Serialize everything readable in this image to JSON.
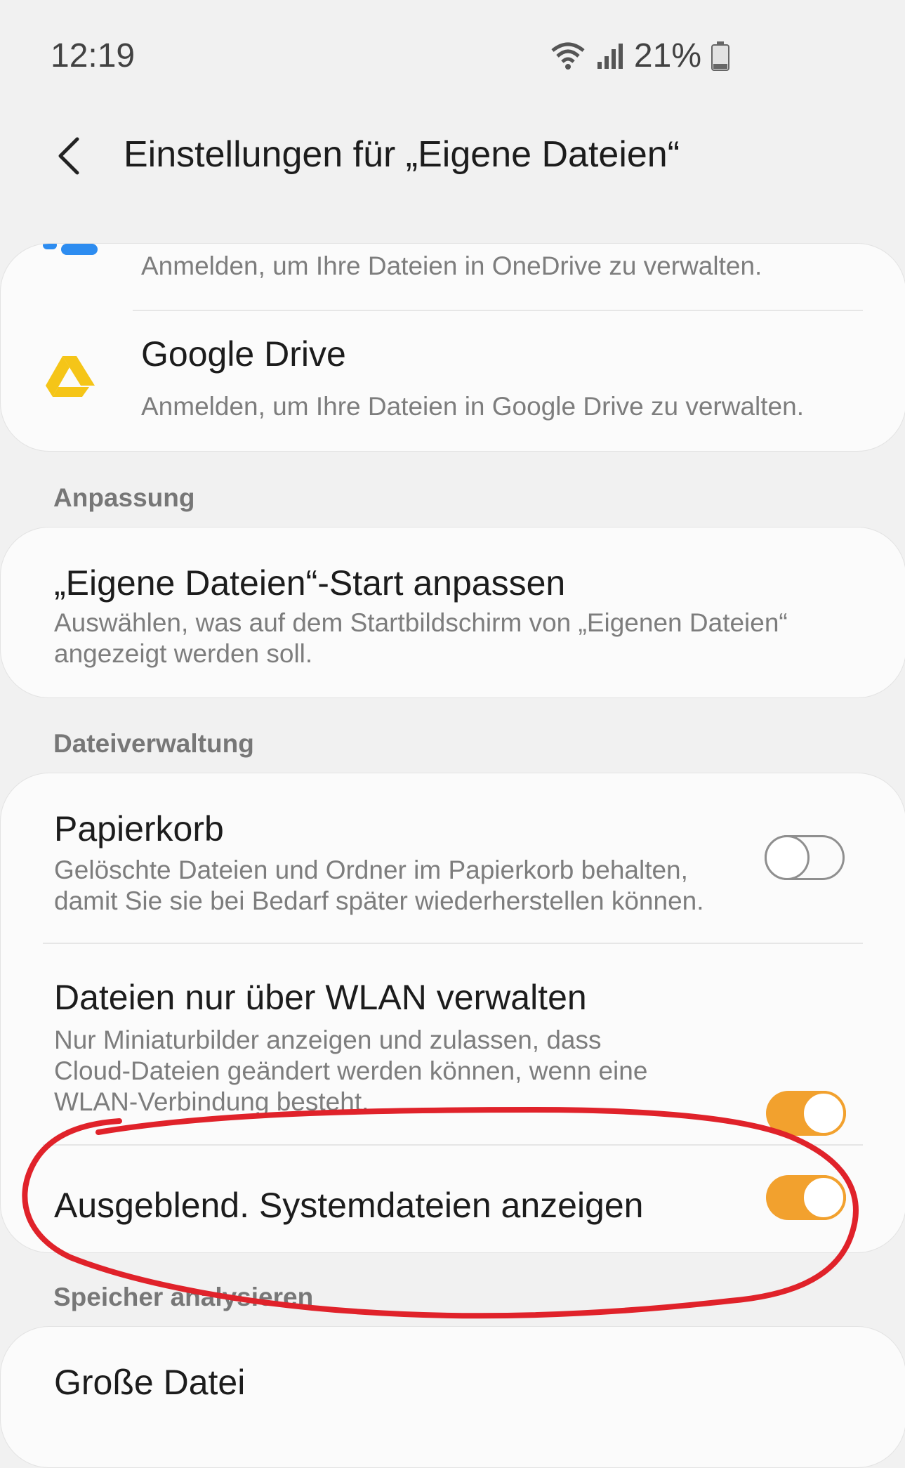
{
  "status_bar": {
    "time": "12:19",
    "battery_percent": "21%",
    "icons": [
      "wifi-icon",
      "signal-icon",
      "battery-icon"
    ]
  },
  "header": {
    "back_icon": "arrow-back-icon",
    "title": "Einstellungen für „Eigene Dateien“"
  },
  "cloud": {
    "onedrive_subtitle": "Anmelden, um Ihre Dateien in OneDrive zu verwalten.",
    "google_drive": {
      "title": "Google Drive",
      "subtitle": "Anmelden, um Ihre Dateien in Google Drive zu verwalten."
    }
  },
  "sections": {
    "customization": "Anpassung",
    "file_management": "Dateiverwaltung",
    "storage": "Speicher analysieren"
  },
  "customize": {
    "title": "„Eigene Dateien“-Start anpassen",
    "subtitle_line1": "Auswählen, was auf dem Startbildschirm von „Eigenen Dateien“",
    "subtitle_line2": "angezeigt werden soll."
  },
  "file_management_items": {
    "trash": {
      "title": "Papierkorb",
      "subtitle_line1": "Gelöschte Dateien und Ordner im Papierkorb behalten,",
      "subtitle_line2": "damit Sie sie bei Bedarf später wiederherstellen können.",
      "enabled": false
    },
    "wifi_only": {
      "title": "Dateien nur über WLAN verwalten",
      "subtitle_line1": "Nur Miniaturbilder anzeigen und zulassen, dass",
      "subtitle_line2": "Cloud-Dateien geändert werden können, wenn eine",
      "subtitle_line3": "WLAN-Verbindung besteht.",
      "enabled": true
    },
    "hidden_files": {
      "title": "Ausgeblend. Systemdateien anzeigen",
      "enabled": true
    }
  },
  "storage_items": {
    "large_files": "Große Datei"
  },
  "colors": {
    "accent_toggle": "#f2a12e",
    "annotation_red": "#e0222a",
    "onedrive_blue": "#2d8cf0",
    "google_drive_yellow": "#f5c518"
  }
}
